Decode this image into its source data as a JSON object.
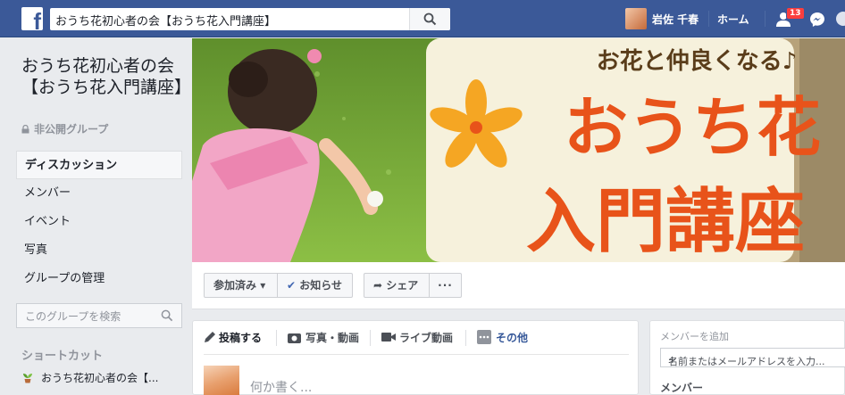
{
  "topbar": {
    "logo_letter": "f",
    "search_value": "おうち花初心者の会【おうち花入門講座】",
    "user_name": "岩佐 千春",
    "home_label": "ホーム",
    "friend_requests_count": "13",
    "icons": [
      "facebook-logo-icon",
      "search-icon",
      "friends-icon",
      "messenger-icon"
    ]
  },
  "sidebar": {
    "group_title": "おうち花初心者の会【おうち花入門講座】",
    "privacy_label": "非公開グループ",
    "nav": [
      {
        "label": "ディスカッション",
        "active": true
      },
      {
        "label": "メンバー"
      },
      {
        "label": "イベント"
      },
      {
        "label": "写真"
      },
      {
        "label": "グループの管理"
      }
    ],
    "search_placeholder": "このグループを検索",
    "shortcuts_heading": "ショートカット",
    "shortcut_item": "おうち花初心者の会【..."
  },
  "cover": {
    "tagline": "お花と仲良くなる♪",
    "title_line1": "おうち花",
    "title_line2": "入門講座"
  },
  "actions": {
    "joined_label": "参加済み",
    "notify_label": "お知らせ",
    "share_label": "シェア",
    "more_label": "···"
  },
  "composer": {
    "tabs": [
      "投稿する",
      "写真・動画",
      "ライブ動画",
      "その他"
    ],
    "placeholder": "何か書く..."
  },
  "members_panel": {
    "add_label": "メンバーを追加",
    "input_placeholder": "名前またはメールアドレスを入力...",
    "members_label": "メンバー"
  },
  "colors": {
    "topbar": "#3b5998",
    "background": "#e9ebee",
    "cover_text": "#e8531a",
    "badge": "#fa3e3e"
  }
}
